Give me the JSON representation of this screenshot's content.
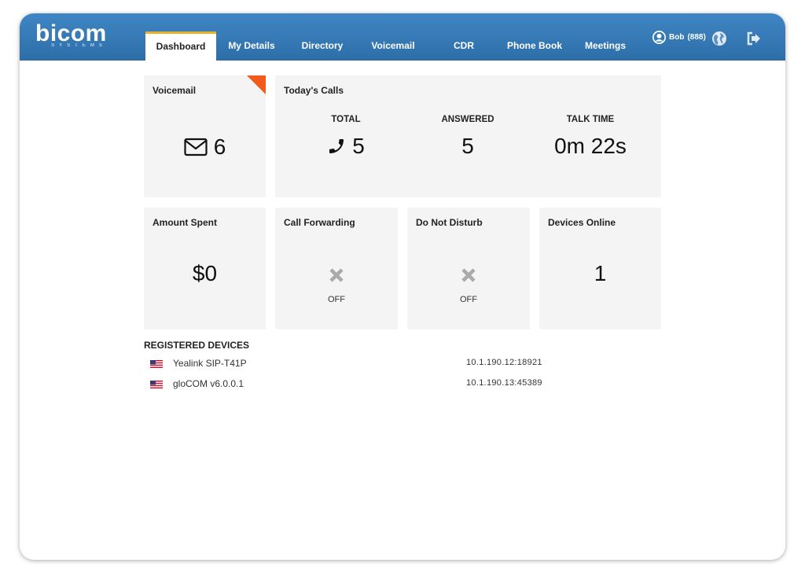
{
  "header": {
    "logo_text": "bicom",
    "logo_subtext": "SYSTEMS",
    "tabs": [
      {
        "label": "Dashboard",
        "active": true
      },
      {
        "label": "My Details"
      },
      {
        "label": "Directory"
      },
      {
        "label": "Voicemail"
      },
      {
        "label": "CDR"
      },
      {
        "label": "Phone Book"
      },
      {
        "label": "Meetings"
      }
    ],
    "user_name": "Bob",
    "user_ext": "(888)",
    "icons": [
      "user-icon",
      "globe-icon",
      "logout-icon"
    ]
  },
  "voicemail": {
    "title": "Voicemail",
    "count": "6",
    "icon": "envelope-icon",
    "corner_color": "#f25a1c"
  },
  "todays_calls": {
    "title": "Today's Calls",
    "total_label": "TOTAL",
    "total_value": "5",
    "answered_label": "ANSWERED",
    "answered_value": "5",
    "talk_time_label": "TALK TIME",
    "talk_time_value": "0m 22s",
    "icon": "phone-icon"
  },
  "amount_spent": {
    "title": "Amount Spent",
    "value": "$0"
  },
  "call_forwarding": {
    "title": "Call Forwarding",
    "status": "OFF",
    "icon": "x-icon"
  },
  "do_not_disturb": {
    "title": "Do Not Disturb",
    "status": "OFF",
    "icon": "x-icon"
  },
  "devices_online": {
    "title": "Devices Online",
    "value": "1"
  },
  "registered_devices": {
    "title": "REGISTERED DEVICES",
    "items": [
      {
        "name": "Yealink SIP-T41P",
        "ip": "10.1.190.12:18921"
      },
      {
        "name": "gloCOM v6.0.0.1",
        "ip": "10.1.190.13:45389"
      }
    ]
  },
  "colors": {
    "header": "#2f72ad",
    "accent_tab": "#e8b030",
    "card_bg": "#f4f4f4"
  }
}
